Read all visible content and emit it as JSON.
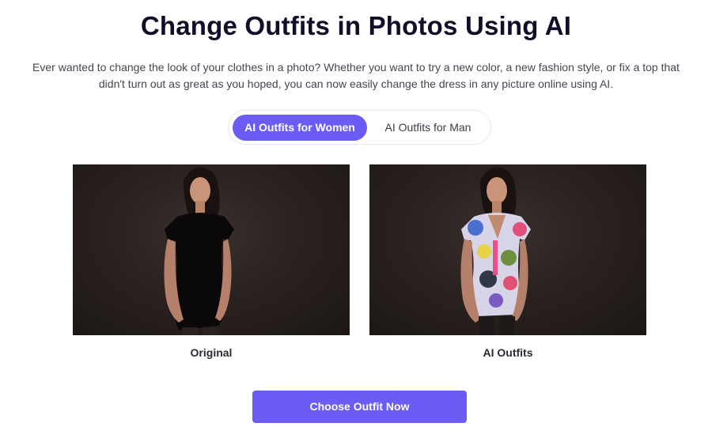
{
  "header": {
    "title": "Change Outfits in Photos Using AI",
    "description": "Ever wanted to change the look of your clothes in a photo? Whether you want to try a new color, a new fashion style, or fix a top that didn't turn out as great as you hoped, you can now easily change the dress in any picture online using AI."
  },
  "tabs": {
    "women_label": "AI Outfits for Women",
    "man_label": "AI Outfits for Man",
    "active": "AI Outfits for Women"
  },
  "comparison": {
    "original_caption": "Original",
    "result_caption": "AI Outfits"
  },
  "cta": {
    "label": "Choose Outfit Now"
  },
  "colors": {
    "accent": "#6b5cf6",
    "title": "#0f0f2a"
  }
}
